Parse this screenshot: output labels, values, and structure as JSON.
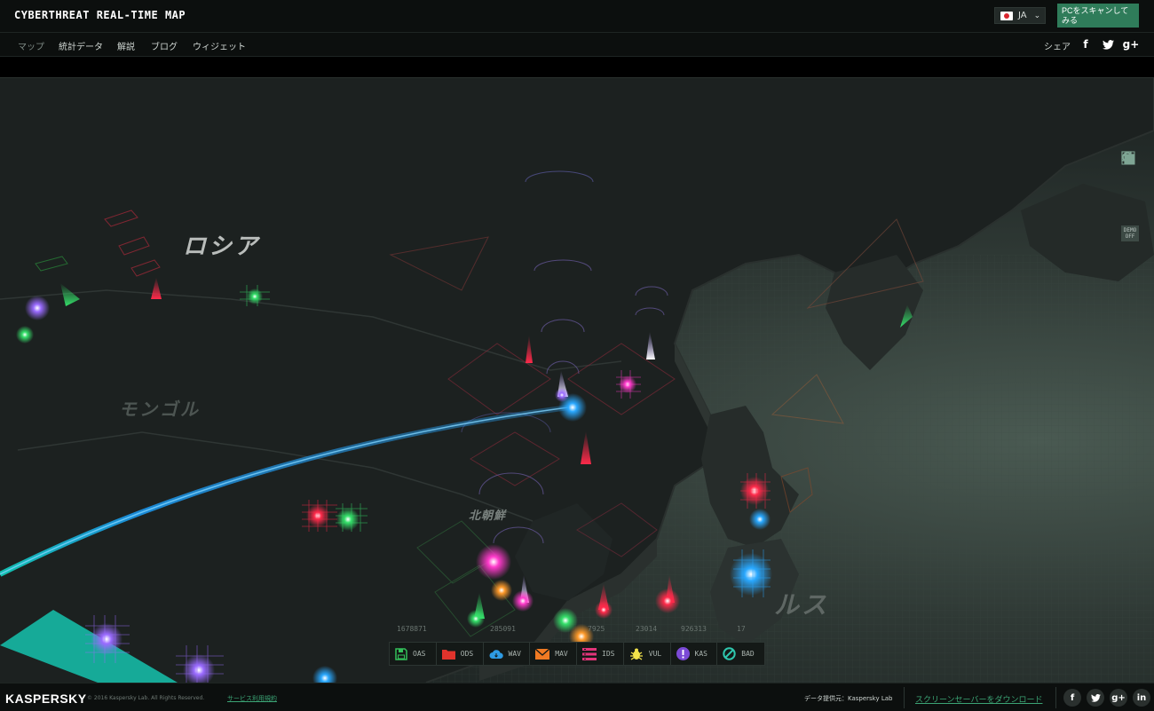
{
  "header": {
    "title": "CYBERTHREAT REAL-TIME MAP",
    "language": "JA",
    "scan_button": "PCをスキャンしてみる"
  },
  "nav": {
    "items": [
      "マップ",
      "統計データ",
      "解説",
      "ブログ",
      "ウィジェット"
    ],
    "active": "マップ",
    "share_label": "シェア",
    "share_icons": [
      "facebook-icon",
      "twitter-icon",
      "google-plus-icon"
    ]
  },
  "map": {
    "labels": {
      "russia": "ロシア",
      "mongolia": "モンゴル",
      "north_korea": "北朝鮮",
      "partial": "ルス"
    },
    "tools": [
      "grid-icon",
      "layers-icon",
      "zoom-in-icon",
      "zoom-out-icon"
    ],
    "demo_label": "DEMO OFF",
    "counters": [
      "1678871",
      "",
      "285091",
      "",
      "7925",
      "23014",
      "926313",
      "17"
    ]
  },
  "legend": [
    {
      "label": "OAS",
      "icon": "save-icon",
      "color": "#33c05a"
    },
    {
      "label": "ODS",
      "icon": "folder-icon",
      "color": "#e1332c"
    },
    {
      "label": "WAV",
      "icon": "cloud-icon",
      "color": "#2e9be3"
    },
    {
      "label": "MAV",
      "icon": "mail-icon",
      "color": "#f07a23"
    },
    {
      "label": "IDS",
      "icon": "ids-icon",
      "color": "#e2357a"
    },
    {
      "label": "VUL",
      "icon": "bug-icon",
      "color": "#f2e24a"
    },
    {
      "label": "KAS",
      "icon": "alert-icon",
      "color": "#7b4ad6"
    },
    {
      "label": "BAD",
      "icon": "block-icon",
      "color": "#2fc7ae"
    }
  ],
  "footer": {
    "logo": "KASPERSKY",
    "copyright": "© 2016 Kaspersky Lab. All Rights Reserved.",
    "terms": "サービス利用規約",
    "provider": "データ提供元：Kaspersky Lab",
    "screensaver": "スクリーンセーバーをダウンロード",
    "social": [
      "facebook-icon",
      "twitter-icon",
      "google-plus-icon",
      "linkedin-icon"
    ]
  }
}
